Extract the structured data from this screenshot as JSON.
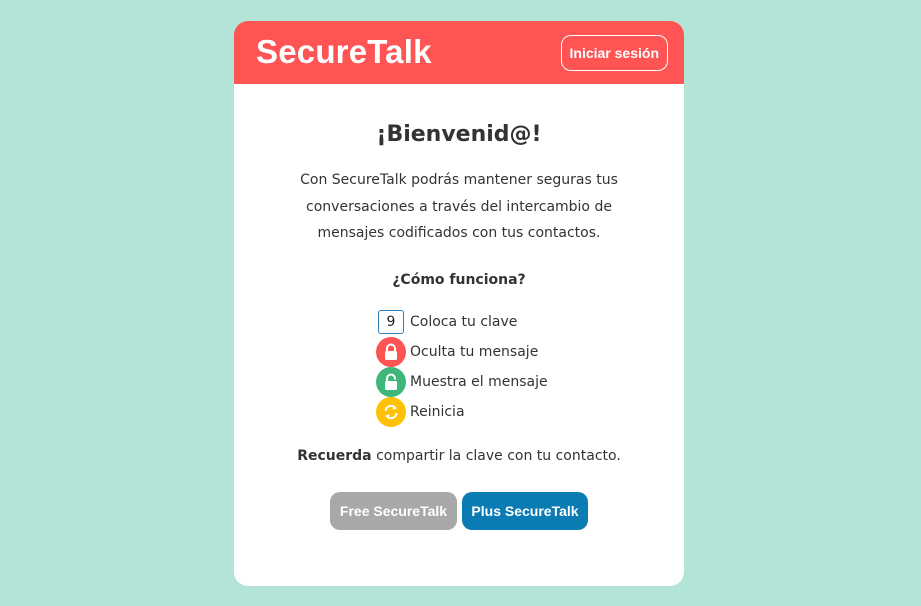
{
  "header": {
    "brand": "SecureTalk",
    "login_label": "Iniciar sesión"
  },
  "main": {
    "welcome": "¡Bienvenid@!",
    "intro": "Con SecureTalk podrás mantener seguras tus conversaciones a través del intercambio de mensajes codificados con tus contactos.",
    "how_title": "¿Cómo funciona?",
    "steps": [
      {
        "icon": "key-box",
        "key_value": "9",
        "label": "Coloca tu clave"
      },
      {
        "icon": "lock-closed-icon",
        "label": "Oculta tu mensaje"
      },
      {
        "icon": "lock-open-icon",
        "label": "Muestra el mensaje"
      },
      {
        "icon": "refresh-icon",
        "label": "Reinicia"
      }
    ],
    "remember_bold": "Recuerda",
    "remember_rest": " compartir la clave con tu contacto.",
    "plans": {
      "free_label": "Free SecureTalk",
      "plus_label": "Plus SecureTalk"
    }
  },
  "colors": {
    "background": "#b2e5d8",
    "header": "#ff5454",
    "lock": "#ff5454",
    "unlock": "#3fb67a",
    "refresh": "#ffc107",
    "free": "#a8a8a8",
    "plus": "#0b7bb3"
  }
}
